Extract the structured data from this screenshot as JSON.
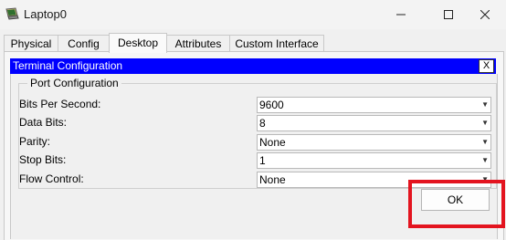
{
  "window": {
    "title": "Laptop0"
  },
  "icons": {
    "app": "laptop-icon",
    "minimize": "minimize-icon",
    "maximize": "maximize-icon",
    "close": "close-icon",
    "dropdown": "chevron-down-icon"
  },
  "tabs": [
    {
      "label": "Physical"
    },
    {
      "label": "Config"
    },
    {
      "label": "Desktop"
    },
    {
      "label": "Attributes"
    },
    {
      "label": "Custom Interface"
    }
  ],
  "active_tab": "Desktop",
  "dialog": {
    "title": "Terminal Configuration",
    "close_label": "X",
    "group_title": "Port Configuration",
    "fields": [
      {
        "label": "Bits Per Second:",
        "value": "9600"
      },
      {
        "label": "Data Bits:",
        "value": "8"
      },
      {
        "label": "Parity:",
        "value": "None"
      },
      {
        "label": "Stop Bits:",
        "value": "1"
      },
      {
        "label": "Flow Control:",
        "value": "None"
      }
    ],
    "ok_label": "OK"
  },
  "colors": {
    "header_bg": "#0000ff",
    "highlight": "#e3141f"
  }
}
